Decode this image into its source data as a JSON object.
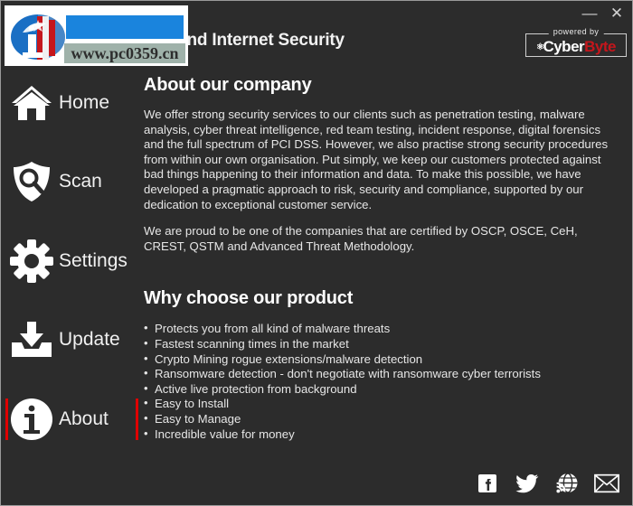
{
  "window": {
    "title": "Antivirus and Internet Security",
    "visible_title_fragment": "irus and Internet Security",
    "minimize_label": "—",
    "close_label": "✕"
  },
  "badge": {
    "powered_by": "powered by",
    "brand_part1": "Cyber",
    "brand_part2": "Byte",
    "brand_accent": "#c5161c"
  },
  "watermark": {
    "url": "www.pc0359.cn",
    "bar_color": "#1a84dd"
  },
  "sidebar": {
    "active_color": "#e00000",
    "items": [
      {
        "label": "Home",
        "icon": "home-icon",
        "active": false
      },
      {
        "label": "Scan",
        "icon": "shield-scan-icon",
        "active": false
      },
      {
        "label": "Settings",
        "icon": "gear-icon",
        "active": false
      },
      {
        "label": "Update",
        "icon": "download-icon",
        "active": false
      },
      {
        "label": "About",
        "icon": "info-icon",
        "active": true
      }
    ]
  },
  "content": {
    "about_heading": "About our company",
    "about_paragraph_1": "We offer strong security services to our clients such as penetration testing, malware analysis, cyber threat intelligence, red team testing, incident response, digital forensics and the full spectrum of PCI DSS. However, we also practise strong security procedures from within our own organisation. Put simply, we keep our customers protected against bad things happening to their information and data. To make this possible, we have developed a pragmatic approach to risk, security and compliance, supported by our dedication to exceptional customer service.",
    "about_paragraph_2": "We are proud to be one of the companies that are certified by OSCP, OSCE, CeH, CREST, QSTM and Advanced Threat Methodology.",
    "why_heading": "Why choose our product",
    "benefits": [
      "Protects you from all kind of malware threats",
      "Fastest scanning times in the market",
      "Crypto Mining rogue extensions/malware detection",
      "Ransomware detection - don't negotiate with ransomware cyber terrorists",
      "Active live protection from background",
      "Easy to Install",
      "Easy to Manage",
      "Incredible value for money"
    ]
  },
  "social": {
    "items": [
      {
        "name": "facebook-icon"
      },
      {
        "name": "twitter-icon"
      },
      {
        "name": "globe-rss-icon"
      },
      {
        "name": "email-icon"
      }
    ]
  }
}
